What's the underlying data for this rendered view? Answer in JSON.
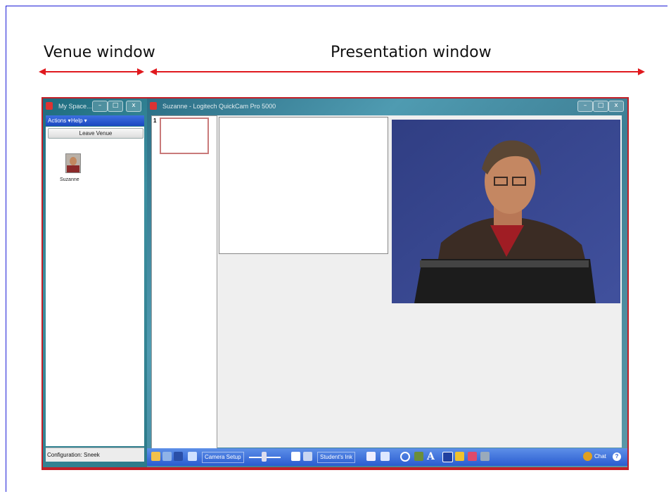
{
  "annotations": {
    "venue_label": "Venue window",
    "presentation_label": "Presentation window",
    "arrow_color": "#e0191e",
    "frame_color": "#1b1bd6"
  },
  "venue_window": {
    "title": "My Space...",
    "menu": [
      "Actions ▾",
      "Help ▾"
    ],
    "leave_button": "Leave Venue",
    "participant": "Suzanne",
    "status": "Configuration: Sneek"
  },
  "presentation_window": {
    "title": "Suzanne - Logitech QuickCam Pro 5000",
    "slide_number": "1",
    "toolbar": {
      "camera_setup": "Camera Setup",
      "students_ink": "Student's Ink",
      "chat": "Chat",
      "help_icon": "?"
    }
  },
  "window_controls": [
    "–",
    "□",
    "x"
  ]
}
